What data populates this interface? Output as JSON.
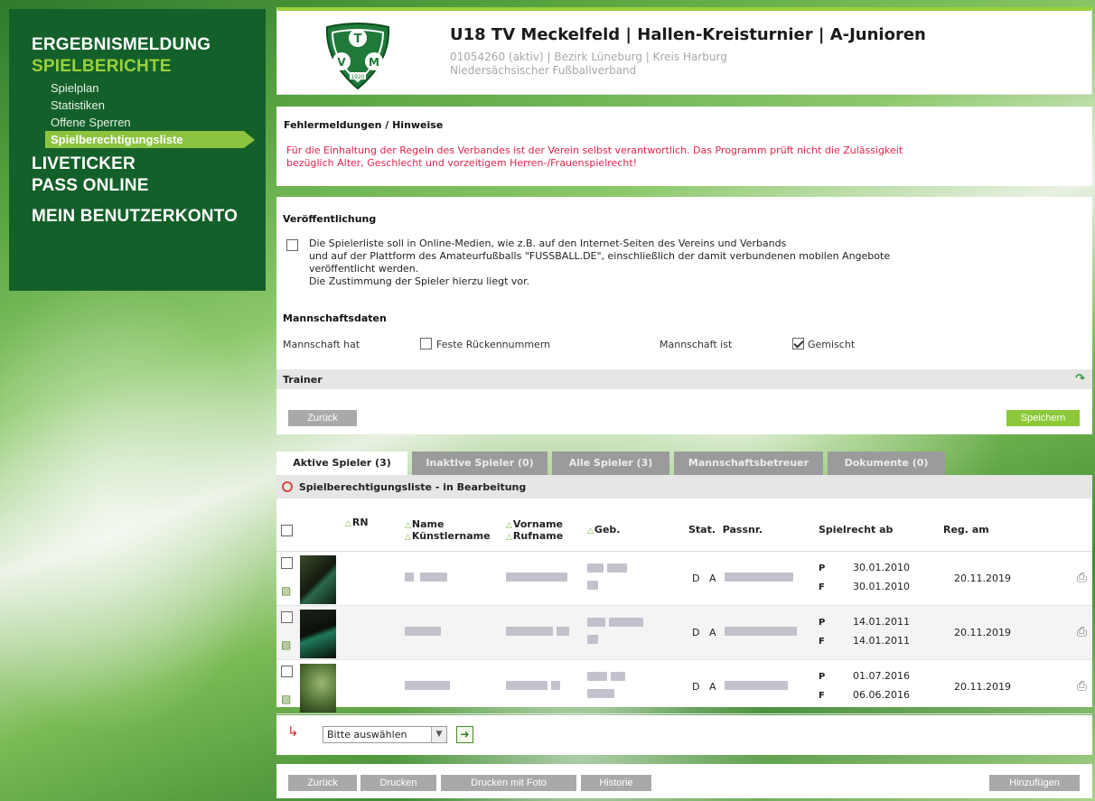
{
  "sidebar": {
    "sections": [
      {
        "label": "ERGEBNISMELDUNG",
        "active": false
      },
      {
        "label": "SPIELBERICHTE",
        "active": true
      }
    ],
    "sub_items": [
      {
        "label": "Spielplan"
      },
      {
        "label": "Statistiken"
      },
      {
        "label": "Offene Sperren"
      },
      {
        "label": "Spielberechtigungsliste"
      }
    ],
    "liveticker": "LIVETICKER",
    "pass_online": "PASS ONLINE",
    "account": "MEIN BENUTZERKONTO"
  },
  "header": {
    "title": "U18 TV Meckelfeld | Hallen-Kreisturnier | A-Junioren",
    "meta_line1": "01054260 (aktiv) | Bezirk Lüneburg | Kreis Harburg",
    "meta_line2": "Niedersächsischer Fußballverband",
    "logo_letters": "TVM",
    "logo_year": "1920"
  },
  "errors": {
    "title": "Fehlermeldungen / Hinweise",
    "line1": "Für die Einhaltung der Regeln des Verbandes ist der Verein selbst verantwortlich. Das Programm prüft nicht die Zulässigkeit",
    "line2": "bezüglich Alter, Geschlecht und vorzeitigem Herren-/Frauenspielrecht!"
  },
  "publication": {
    "title": "Veröffentlichung",
    "line1": "Die Spielerliste soll in Online-Medien, wie z.B. auf den Internet-Seiten des Vereins und Verbands",
    "line2": "und auf der Plattform des Amateurfußballs \"FUSSBALL.DE\", einschließlich der damit verbundenen mobilen Angebote",
    "line3": "veröffentlicht werden.",
    "line4": "Die Zustimmung der Spieler hierzu liegt vor.",
    "checked": false
  },
  "team": {
    "title": "Mannschaftsdaten",
    "has_label": "Mannschaft hat",
    "fixed_numbers": "Feste Rückennummern",
    "is_label": "Mannschaft ist",
    "mixed": "Gemischt"
  },
  "trainer": {
    "label": "Trainer"
  },
  "buttons": {
    "back": "Zurück",
    "save": "Speichern",
    "print": "Drucken",
    "print_photo": "Drucken mit Foto",
    "history": "Historie",
    "add": "Hinzufügen"
  },
  "tabs": [
    {
      "label": "Aktive Spieler (3)",
      "active": true
    },
    {
      "label": "Inaktive Spieler (0)",
      "active": false
    },
    {
      "label": "Alle Spieler (3)",
      "active": false
    },
    {
      "label": "Mannschaftsbetreuer",
      "active": false
    },
    {
      "label": "Dokumente (0)",
      "active": false
    }
  ],
  "list": {
    "title": "Spielberechtigungsliste - in Bearbeitung",
    "columns": {
      "rn": "RN",
      "name": "Name",
      "artist": "Künstlername",
      "first": "Vorname",
      "nick": "Rufname",
      "birth": "Geb.",
      "stat": "Stat.",
      "pass": "Passnr.",
      "right": "Spielrecht ab",
      "reg": "Reg. am"
    },
    "rows": [
      {
        "nat": "D",
        "stat": "A",
        "p": "30.01.2010",
        "f": "30.01.2010",
        "reg": "20.11.2019"
      },
      {
        "nat": "D",
        "stat": "A",
        "p": "14.01.2011",
        "f": "14.01.2011",
        "reg": "20.11.2019"
      },
      {
        "nat": "D",
        "stat": "A",
        "p": "01.07.2016",
        "f": "06.06.2016",
        "reg": "20.11.2019"
      }
    ]
  },
  "action": {
    "select_value": "Bitte auswählen"
  },
  "colors": {
    "brand_dark": "#14602a",
    "accent": "#9ad13c",
    "warning": "#e0234a"
  }
}
